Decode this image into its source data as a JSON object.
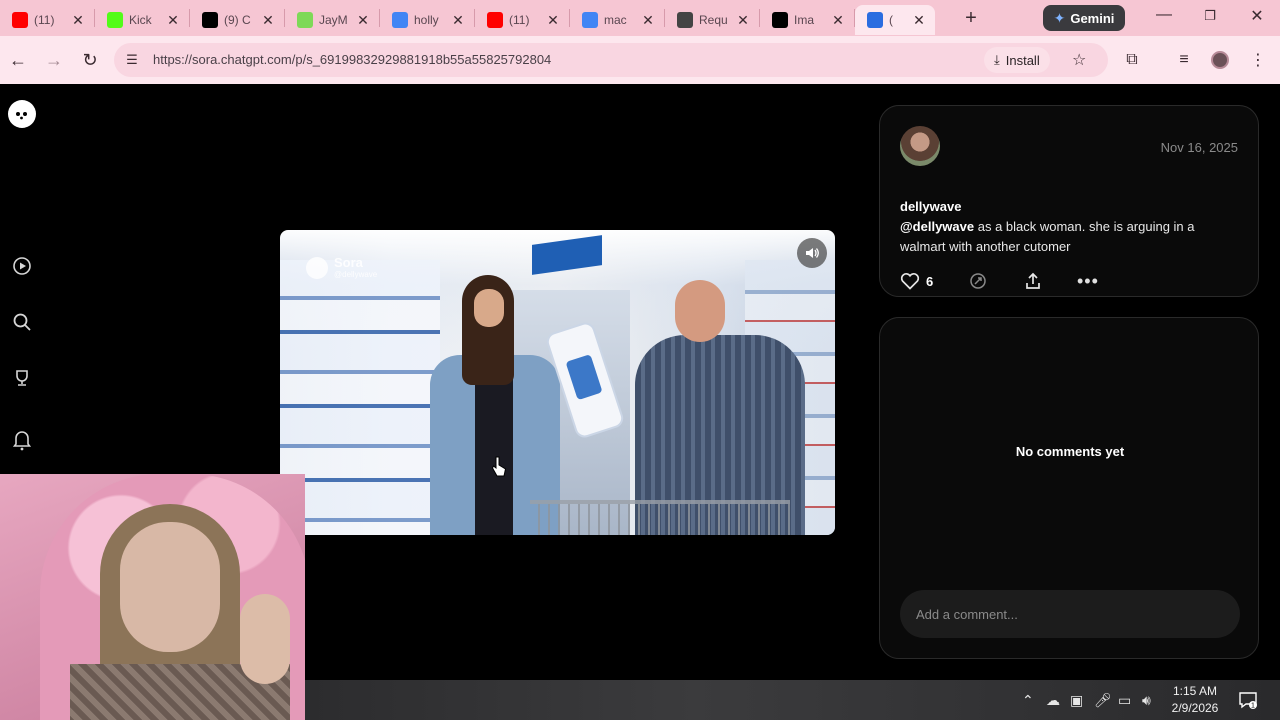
{
  "browser": {
    "tabs": [
      {
        "title": "(11)",
        "favicon": "youtube-icon",
        "color": "#ff0000"
      },
      {
        "title": "Kick",
        "favicon": "kick-icon",
        "color": "#53fc18"
      },
      {
        "title": "(9) C",
        "favicon": "x-icon",
        "color": "#000000"
      },
      {
        "title": "JayM",
        "favicon": "play-icon",
        "color": "#7ed957"
      },
      {
        "title": "holly",
        "favicon": "google-icon",
        "color": "#4285f4"
      },
      {
        "title": "(11)",
        "favicon": "youtube-icon",
        "color": "#ff0000"
      },
      {
        "title": "mac",
        "favicon": "google-icon",
        "color": "#4285f4"
      },
      {
        "title": "Requ",
        "favicon": "openai-icon",
        "color": "#444444"
      },
      {
        "title": "Ima",
        "favicon": "openai-icon",
        "color": "#000000"
      },
      {
        "title": "(",
        "favicon": "sora-icon",
        "color": "#2b6de0"
      }
    ],
    "gemini_label": "Gemini",
    "url": "https://sora.chatgpt.com/p/s_69199832929881918b55a55825792804",
    "install_label": "Install"
  },
  "post": {
    "date": "Nov 16, 2025",
    "username": "dellywave",
    "mention": "@dellywave",
    "caption": " as a black woman. she is arguing in a walmart with another cutomer",
    "likes": "6"
  },
  "video": {
    "watermark_brand": "Sora",
    "watermark_handle": "@dellywave"
  },
  "comments": {
    "empty_text": "No comments yet",
    "placeholder": "Add a comment..."
  },
  "taskbar": {
    "time": "1:15 AM",
    "date": "2/9/2026",
    "notification_count": "1"
  }
}
